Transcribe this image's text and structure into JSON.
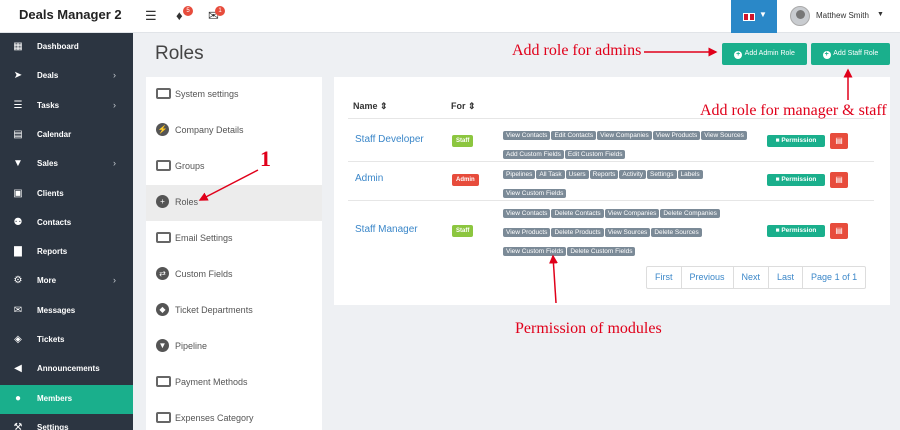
{
  "app": {
    "title": "Deals Manager 2"
  },
  "topbar": {
    "notification_count": "5",
    "message_count": "1",
    "language_flag": "uk-flag-icon",
    "user_name": "Matthew Smith"
  },
  "sidebar": {
    "items": [
      {
        "label": "Dashboard",
        "icon": "dashboard-icon",
        "has_arrow": false
      },
      {
        "label": "Deals",
        "icon": "rocket-icon",
        "has_arrow": true
      },
      {
        "label": "Tasks",
        "icon": "list-icon",
        "has_arrow": true
      },
      {
        "label": "Calendar",
        "icon": "calendar-icon",
        "has_arrow": false
      },
      {
        "label": "Sales",
        "icon": "cart-icon",
        "has_arrow": true
      },
      {
        "label": "Clients",
        "icon": "building-icon",
        "has_arrow": false
      },
      {
        "label": "Contacts",
        "icon": "users-icon",
        "has_arrow": false
      },
      {
        "label": "Reports",
        "icon": "chart-icon",
        "has_arrow": false
      },
      {
        "label": "More",
        "icon": "gear-icon",
        "has_arrow": true
      },
      {
        "label": "Messages",
        "icon": "envelope-icon",
        "has_arrow": false
      },
      {
        "label": "Tickets",
        "icon": "ticket-icon",
        "has_arrow": false
      },
      {
        "label": "Announcements",
        "icon": "megaphone-icon",
        "has_arrow": false
      },
      {
        "label": "Members",
        "icon": "user-icon",
        "has_arrow": false,
        "active": true
      },
      {
        "label": "Settings",
        "icon": "wrench-icon",
        "has_arrow": false
      }
    ]
  },
  "page": {
    "title": "Roles",
    "add_admin_label": "Add Admin Role",
    "add_staff_label": "Add Staff Role"
  },
  "settings_menu": {
    "items": [
      {
        "label": "System settings",
        "icon": "monitor-icon"
      },
      {
        "label": "Company Details",
        "icon": "bolt-icon"
      },
      {
        "label": "Groups",
        "icon": "square-icon"
      },
      {
        "label": "Roles",
        "icon": "plus-circle-icon",
        "active": true
      },
      {
        "label": "Email Settings",
        "icon": "envelope-icon"
      },
      {
        "label": "Custom Fields",
        "icon": "shuffle-icon"
      },
      {
        "label": "Ticket Departments",
        "icon": "tag-icon"
      },
      {
        "label": "Pipeline",
        "icon": "filter-icon"
      },
      {
        "label": "Payment Methods",
        "icon": "money-icon"
      },
      {
        "label": "Expenses Category",
        "icon": "money-icon"
      }
    ]
  },
  "roles_table": {
    "columns": {
      "name": "Name",
      "for": "For"
    },
    "permission_button": "Permission",
    "rows": [
      {
        "name": "Staff Developer",
        "for": "Staff",
        "for_color": "#8cc63f",
        "permissions": [
          "View Contacts",
          "Edit Contacts",
          "View Companies",
          "View Products",
          "View Sources",
          "Add Custom Fields",
          "Edit Custom Fields"
        ]
      },
      {
        "name": "Admin",
        "for": "Admin",
        "for_color": "#e74c3c",
        "permissions": [
          "Pipelines",
          "All Task",
          "Users",
          "Reports",
          "Activity",
          "Settings",
          "Labels",
          "View Custom Fields"
        ]
      },
      {
        "name": "Staff Manager",
        "for": "Staff",
        "for_color": "#8cc63f",
        "permissions": [
          "View Contacts",
          "Delete Contacts",
          "View Companies",
          "Delete Companies",
          "View Products",
          "Delete Products",
          "View Sources",
          "Delete Sources",
          "View Custom Fields",
          "Delete Custom Fields"
        ]
      }
    ]
  },
  "pagination": {
    "first": "First",
    "previous": "Previous",
    "next": "Next",
    "last": "Last",
    "page_info": "Page 1 of 1"
  },
  "annotations": {
    "admin_note": "Add role for admins",
    "staff_note": "Add role for manager & staff",
    "number_marker": "1",
    "permission_note": "Permission of modules"
  },
  "colors": {
    "accent": "#1aaf8c",
    "sidebar_bg": "#2c3541",
    "link": "#3b87c9",
    "danger": "#e74c3c",
    "annotation": "#e0001a"
  }
}
